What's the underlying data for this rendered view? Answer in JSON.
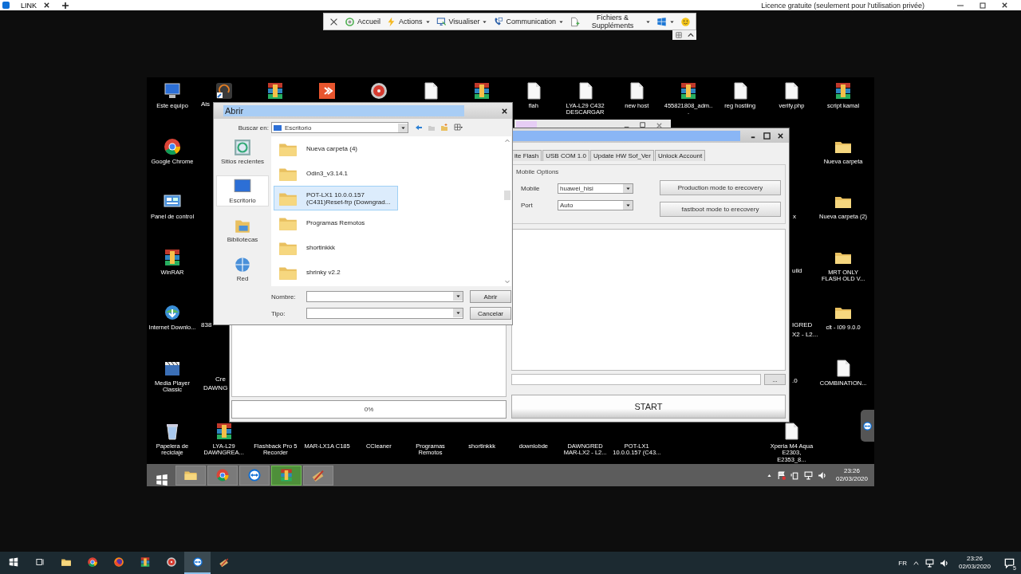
{
  "app_tab": {
    "label": "LINK"
  },
  "license_note": "Licence gratuite (seulement pour l'utilisation privée)",
  "toolbar": [
    {
      "kind": "close",
      "dropdown": false
    },
    {
      "kind": "home",
      "label": "Accueil",
      "dropdown": false
    },
    {
      "kind": "actions",
      "label": "Actions",
      "dropdown": true
    },
    {
      "kind": "view",
      "label": "Visualiser",
      "dropdown": true
    },
    {
      "kind": "comm",
      "label": "Communication",
      "dropdown": true
    },
    {
      "kind": "files",
      "label": "Fichiers & Suppléments",
      "dropdown": true
    },
    {
      "kind": "windows",
      "dropdown": true
    },
    {
      "kind": "smiley",
      "dropdown": false
    }
  ],
  "desktop": {
    "icons": [
      {
        "label": "Este equipo",
        "kind": "computer"
      },
      {
        "label": "Google Chrome",
        "kind": "chrome"
      },
      {
        "label": "Panel de control",
        "kind": "control"
      },
      {
        "label": "WinRAR",
        "kind": "winrar"
      },
      {
        "label": "Internet Downlo...",
        "kind": "download"
      },
      {
        "label": "Media Player Classic",
        "kind": "media"
      },
      {
        "label": "Papelera de reciclaje",
        "kind": "recycle"
      },
      {
        "label": "LYA-L29 DAWNGREA...",
        "kind": "winrar"
      },
      {
        "label": "Flashback Pro 5 Recorder",
        "kind": "covered"
      },
      {
        "label": "MAR-LX1A C185",
        "kind": "covered"
      },
      {
        "label": "CCleaner",
        "kind": "covered"
      },
      {
        "label": "Programas Remotos",
        "kind": "covered"
      },
      {
        "label": "shortinkkk",
        "kind": "covered"
      },
      {
        "label": "downlobde",
        "kind": "covered"
      },
      {
        "label": "DAWNGRED MAR-LX2 - L2...",
        "kind": "covered"
      },
      {
        "label": "POT-LX1 10.0.0.157 (C43...",
        "kind": "covered"
      },
      {
        "label": "Xperia M4 Aqua E2303, E2353_8...",
        "kind": "file"
      },
      {
        "label": "flah",
        "kind": "file"
      },
      {
        "label": "LYA-L29 C432 DESCARGAR",
        "kind": "file"
      },
      {
        "label": "new host",
        "kind": "file"
      },
      {
        "label": "455821808_adm...",
        "kind": "winrar"
      },
      {
        "label": "reg hostiing",
        "kind": "file"
      },
      {
        "label": "verify.php",
        "kind": "file"
      },
      {
        "label": "script kamal",
        "kind": "winrar"
      },
      {
        "label": "Nueva carpeta",
        "kind": "folder"
      },
      {
        "label": "Nueva carpeta (2)",
        "kind": "folder"
      },
      {
        "label": "MRT ONLY FLASH OLD V...",
        "kind": "folder"
      },
      {
        "label": "clt - I09 9.0.0",
        "kind": "folder"
      },
      {
        "label": "COMBINATION...",
        "kind": "file"
      },
      {
        "kind": "app"
      },
      {
        "kind": "winrar"
      },
      {
        "kind": "orange"
      },
      {
        "kind": "disc"
      },
      {
        "kind": "file"
      },
      {
        "kind": "winrar"
      }
    ],
    "fragments": [
      "Ais",
      "838",
      "Cre",
      "DAWNG",
      "x",
      "uild",
      "IGRED",
      "X2 - L2...",
      ".0"
    ]
  },
  "background_window": {
    "kind": "window"
  },
  "tool_window": {
    "tabs": [
      {
        "label": "ite Flash"
      },
      {
        "label": "USB COM 1.0"
      },
      {
        "label": "Update HW Sof_Ver"
      },
      {
        "label": "Unlock Account"
      }
    ],
    "group_title": "Mobile Options",
    "fields": [
      {
        "label": "Mobile",
        "value": "huawei_hisi"
      },
      {
        "label": "Port",
        "value": "Auto"
      }
    ],
    "actions": [
      "Production mode to erecovery",
      "fastboot mode to erecovery"
    ],
    "progress": {
      "level": 0,
      "reading": "0%"
    },
    "browse_button": "...",
    "start_button": "START"
  },
  "dialog": {
    "title": "Abrir",
    "look_in_label": "Buscar en:",
    "look_in": "Escritorio",
    "places": [
      {
        "label": "Sitios recientes",
        "kind": "recent",
        "selected": false
      },
      {
        "label": "Escritorio",
        "kind": "desktop",
        "selected": true
      },
      {
        "label": "Bibliotecas",
        "kind": "libraries",
        "selected": false
      },
      {
        "label": "Red",
        "kind": "network",
        "selected": false
      }
    ],
    "files": [
      {
        "name": "Nueva carpeta (4)",
        "selected": false
      },
      {
        "name": "Odin3_v3.14.1",
        "selected": false
      },
      {
        "name": "POT-LX1 10.0.0.157 (C431)Reset-frp (Downgrad...",
        "selected": true
      },
      {
        "name": "Programas Remotos",
        "selected": false
      },
      {
        "name": "shortinkkk",
        "selected": false
      },
      {
        "name": "shrinky v2.2",
        "selected": false
      }
    ],
    "name_label": "Nombre:",
    "type_label": "Tipo:",
    "open_button": "Abrir",
    "cancel_button": "Cancelar"
  },
  "remote_taskbar": {
    "apps": [
      {
        "kind": "start",
        "active": false
      },
      {
        "kind": "folder",
        "active": false
      },
      {
        "kind": "chrome",
        "active": false
      },
      {
        "kind": "teamviewer",
        "active": false
      },
      {
        "kind": "winrar",
        "active": true
      },
      {
        "kind": "tools",
        "active": false
      }
    ],
    "time": "23:26",
    "date": "02/03/2020"
  },
  "local_taskbar": {
    "apps": [
      {
        "kind": "start",
        "active": false
      },
      {
        "kind": "taskview",
        "active": false
      },
      {
        "kind": "folder",
        "active": false
      },
      {
        "kind": "chrome",
        "active": false
      },
      {
        "kind": "firefox",
        "active": false
      },
      {
        "kind": "winrar",
        "active": false
      },
      {
        "kind": "disc",
        "active": false
      },
      {
        "kind": "teamviewer",
        "active": true
      },
      {
        "kind": "tools",
        "active": false
      }
    ],
    "language": "FR",
    "time": "23:26",
    "date": "02/03/2020",
    "notifications": "5"
  }
}
